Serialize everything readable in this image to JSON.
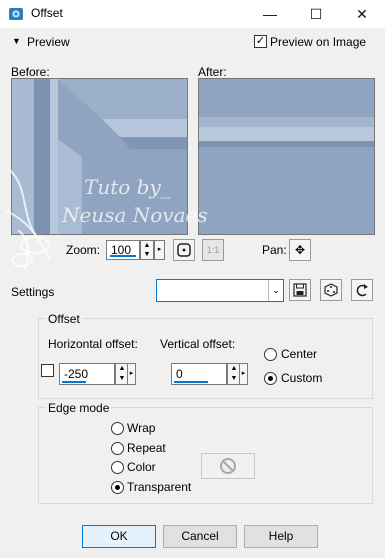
{
  "window": {
    "title": "Offset",
    "controls": {
      "minimize": "—",
      "maximize": "☐",
      "close": "✕"
    }
  },
  "preview": {
    "toggle_label": "Preview",
    "preview_on_image_label": "Preview on Image",
    "preview_on_image_checked": true,
    "before_label": "Before:",
    "after_label": "After:"
  },
  "watermark": {
    "line1": "Tuto by_",
    "line2": "Neusa Novaes"
  },
  "zoom": {
    "label": "Zoom:",
    "value": "100",
    "fit_label": "1:1"
  },
  "pan": {
    "label": "Pan:",
    "icon": "✥"
  },
  "settings": {
    "label": "Settings",
    "value": ""
  },
  "offset": {
    "group_label": "Offset",
    "horizontal_label": "Horizontal offset:",
    "horizontal_value": "-250",
    "vertical_label": "Vertical offset:",
    "vertical_value": "0",
    "center_label": "Center",
    "custom_label": "Custom",
    "selected": "Custom"
  },
  "edge_mode": {
    "group_label": "Edge mode",
    "options": [
      "Wrap",
      "Repeat",
      "Color",
      "Transparent"
    ],
    "selected": "Transparent"
  },
  "buttons": {
    "ok": "OK",
    "cancel": "Cancel",
    "help": "Help"
  },
  "colors": {
    "preview_blue": "#8ea3bf",
    "accent": "#0078d7",
    "dialog_bg": "#f0f0f0"
  }
}
